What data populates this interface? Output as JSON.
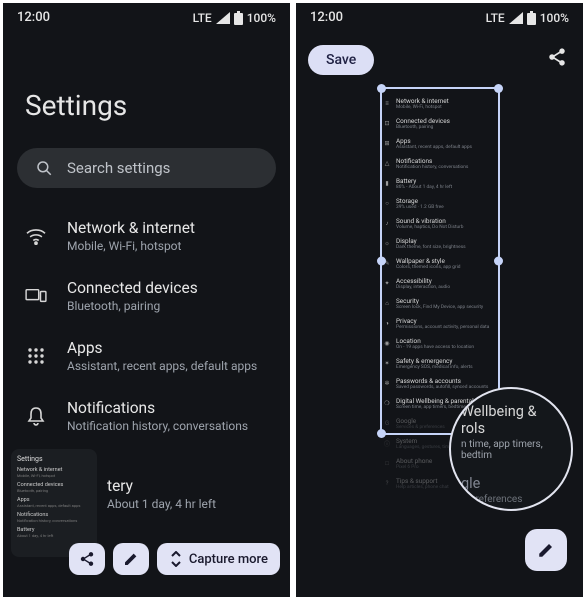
{
  "status": {
    "time": "12:00",
    "network": "LTE",
    "battery": "100%"
  },
  "left": {
    "title": "Settings",
    "search_placeholder": "Search settings",
    "items": [
      {
        "icon": "wifi",
        "title": "Network & internet",
        "sub": "Mobile, Wi-Fi, hotspot"
      },
      {
        "icon": "devices",
        "title": "Connected devices",
        "sub": "Bluetooth, pairing"
      },
      {
        "icon": "apps",
        "title": "Apps",
        "sub": "Assistant, recent apps, default apps"
      },
      {
        "icon": "bell",
        "title": "Notifications",
        "sub": "Notification history, conversations"
      }
    ],
    "partial_item": {
      "title": "tery",
      "sub": "About 1 day, 4 hr left"
    },
    "mini_preview": {
      "title": "Settings",
      "rows": [
        {
          "t": "Network & internet",
          "s": "Mobile, Wi-Fi, hotspot"
        },
        {
          "t": "Connected devices",
          "s": "Bluetooth, pairing"
        },
        {
          "t": "Apps",
          "s": "Assistant, recent apps, default apps"
        },
        {
          "t": "Notifications",
          "s": "Notification history, conversations"
        },
        {
          "t": "Battery",
          "s": "About 1 day, 4 hr left"
        }
      ]
    },
    "actions": {
      "share": "",
      "edit": "",
      "capture_more": "Capture more"
    }
  },
  "right": {
    "save_label": "Save",
    "long_items": [
      {
        "icon": "≡",
        "t": "Network & internet",
        "s": "Mobile, Wi-Fi, hotspot"
      },
      {
        "icon": "⊡",
        "t": "Connected devices",
        "s": "Bluetooth, pairing"
      },
      {
        "icon": "⊞",
        "t": "Apps",
        "s": "Assistant, recent apps, default apps"
      },
      {
        "icon": "△",
        "t": "Notifications",
        "s": "Notification history, conversations"
      },
      {
        "icon": "▮",
        "t": "Battery",
        "s": "86% - About 1 day, 4 hr left"
      },
      {
        "icon": "○",
        "t": "Storage",
        "s": "39% used · 1.2 GB free"
      },
      {
        "icon": "♪",
        "t": "Sound & vibration",
        "s": "Volume, haptics, Do Not Disturb"
      },
      {
        "icon": "☼",
        "t": "Display",
        "s": "Dark theme, font size, brightness"
      },
      {
        "icon": "✎",
        "t": "Wallpaper & style",
        "s": "Colors, themed icons, app grid"
      },
      {
        "icon": "✦",
        "t": "Accessibility",
        "s": "Display, interaction, audio"
      },
      {
        "icon": "⌂",
        "t": "Security",
        "s": "Screen lock, Find My Device, app security"
      },
      {
        "icon": "◑",
        "t": "Privacy",
        "s": "Permissions, account activity, personal data"
      },
      {
        "icon": "◉",
        "t": "Location",
        "s": "On - 19 apps have access to location"
      },
      {
        "icon": "✶",
        "t": "Safety & emergency",
        "s": "Emergency SOS, medical info, alerts"
      },
      {
        "icon": "✲",
        "t": "Passwords & accounts",
        "s": "Saved passwords, autofill, synced accounts"
      },
      {
        "icon": "❍",
        "t": "Digital Wellbeing & parental controls",
        "s": "Screen time, app timers, bedtime"
      },
      {
        "icon": "G",
        "t": "Google",
        "s": "Services & preferences",
        "dim": true
      },
      {
        "icon": "ⓘ",
        "t": "System",
        "s": "Languages, gestures, time",
        "dim": true
      },
      {
        "icon": "□",
        "t": "About phone",
        "s": "Pixel 6 Pro",
        "dim": true
      },
      {
        "icon": "?",
        "t": "Tips & support",
        "s": "Help articles, phone chat",
        "dim": true
      }
    ],
    "loupe": {
      "row1a": "Wellbeing &",
      "row1b": "rols",
      "sub1": "n time, app timers, bedtim",
      "row2": "gle",
      "sub2": "& preferences"
    }
  }
}
